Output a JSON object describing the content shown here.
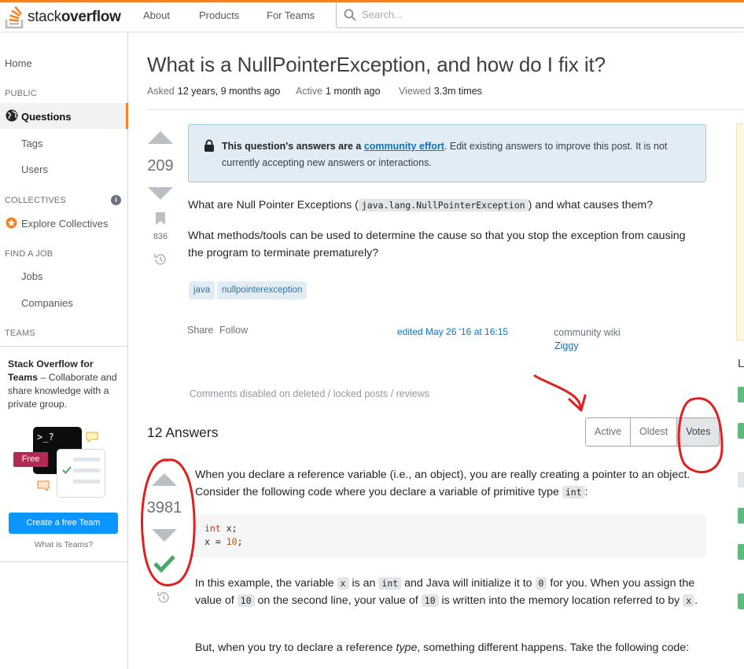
{
  "brand": {
    "name_regular": "stack",
    "name_bold": "overflow"
  },
  "nav": {
    "about": "About",
    "products": "Products",
    "for_teams": "For Teams"
  },
  "search": {
    "placeholder": "Search..."
  },
  "sidebar": {
    "home": "Home",
    "public_heading": "PUBLIC",
    "questions": "Questions",
    "tags": "Tags",
    "users": "Users",
    "collectives_heading": "COLLECTIVES",
    "explore_collectives": "Explore Collectives",
    "find_job_heading": "FIND A JOB",
    "jobs": "Jobs",
    "companies": "Companies",
    "teams_heading": "TEAMS",
    "teams_title": "Stack Overflow for Teams",
    "teams_desc": " – Collaborate and share knowledge with a private group.",
    "free_badge": "Free",
    "terminal_prompt": ">_?",
    "create_team_button": "Create a free Team",
    "what_is_teams": "What is Teams?"
  },
  "question": {
    "title": "What is a NullPointerException, and how do I fix it?",
    "asked_label": "Asked",
    "asked_value": "12 years, 9 months ago",
    "active_label": "Active",
    "active_value": "1 month ago",
    "viewed_label": "Viewed",
    "viewed_value": "3.3m times",
    "votes": "209",
    "bookmarks": "836",
    "notice_bold": "This question's answers are a",
    "notice_link": "community effort",
    "notice_rest": ". Edit existing answers to improve this post. It is not currently accepting new answers or interactions.",
    "p1_before": "What are Null Pointer Exceptions (",
    "p1_code": "java.lang.NullPointerException",
    "p1_after": ") and what causes them?",
    "p2": "What methods/tools can be used to determine the cause so that you stop the exception from causing the program to terminate prematurely?",
    "tags": [
      "java",
      "nullpointerexception"
    ],
    "share": "Share",
    "follow": "Follow",
    "edited": "edited May 26 '16 at 16:15",
    "community_wiki": "community wiki",
    "wiki_user": "Ziggy",
    "comments_note": "Comments disabled on deleted / locked posts / reviews"
  },
  "answers": {
    "heading": "12 Answers",
    "sort_options": [
      "Active",
      "Oldest",
      "Votes"
    ],
    "top_votes": "3981",
    "a_p1_before": "When you declare a reference variable (i.e., an object), you are really creating a pointer to an object. Consider the following code where you declare a variable of primitive type ",
    "a_p1_code": "int",
    "a_p1_after": ":",
    "code_line1_kw": "int",
    "code_line1_rest": " x;",
    "code_line2_pre": "x = ",
    "code_line2_num": "10",
    "code_line2_post": ";",
    "a_p2_t1": "In this example, the variable ",
    "a_p2_c1": "x",
    "a_p2_t2": " is an ",
    "a_p2_c2": "int",
    "a_p2_t3": " and Java will initialize it to ",
    "a_p2_c3": "0",
    "a_p2_t4": " for you. When you assign the value of ",
    "a_p2_c4": "10",
    "a_p2_t5": " on the second line, your value of ",
    "a_p2_c5": "10",
    "a_p2_t6": " is written into the memory location referred to by ",
    "a_p2_c6": "x",
    "a_p2_t7": ".",
    "a_p3_t1": "But, when you try to declare a reference ",
    "a_p3_em": "type",
    "a_p3_t2": ", something different happens. Take the following code:"
  },
  "right_panel": {
    "letter": "L"
  },
  "colors": {
    "accent": "#f48225",
    "link": "#0a74c4",
    "accepted": "#48a868",
    "annotation": "#e02020"
  }
}
